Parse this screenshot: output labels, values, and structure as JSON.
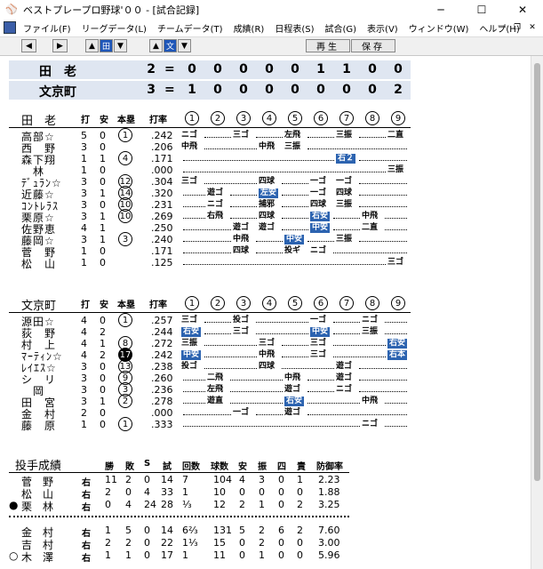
{
  "window": {
    "title": "ベストプレープロ野球'００ - [試合記録]",
    "minimize": "─",
    "maximize": "☐",
    "close": "✕"
  },
  "menu": [
    "ファイル(F)",
    "リーグデータ(L)",
    "チームデータ(T)",
    "成績(R)",
    "日程表(S)",
    "試合(G)",
    "表示(V)",
    "ウィンドウ(W)",
    "ヘルプ(H)"
  ],
  "toolbar": {
    "replay": "再生",
    "save": "保存",
    "ta": "田",
    "bun": "文"
  },
  "innings": [
    "1",
    "2",
    "3",
    "4",
    "5",
    "6",
    "7",
    "8",
    "9"
  ],
  "score": [
    {
      "team": "田　老",
      "total": "2",
      "eq": "=",
      "innings": [
        "0",
        "0",
        "0",
        "0",
        "0",
        "1",
        "1",
        "0",
        "0"
      ]
    },
    {
      "team": "文京町",
      "total": "3",
      "eq": "=",
      "innings": [
        "1",
        "0",
        "0",
        "0",
        "0",
        "0",
        "0",
        "0",
        "2"
      ]
    }
  ],
  "batting_headers": {
    "da": "打",
    "an": "安",
    "hr": "本塁",
    "avg": "打率"
  },
  "team1": {
    "name": "田　老",
    "players": [
      {
        "name": "高部☆",
        "ab": "5",
        "h": "0",
        "hr": "1",
        "hrstyle": "o",
        "avg": ".242",
        "res": [
          [
            0,
            "ニゴ"
          ],
          [
            2,
            "三ゴ"
          ],
          [
            4,
            "左飛"
          ],
          [
            6,
            "三振"
          ],
          [
            8,
            "二直"
          ]
        ]
      },
      {
        "name": "西　野",
        "ab": "3",
        "h": "0",
        "hr": "",
        "hrstyle": "",
        "avg": ".206",
        "res": [
          [
            0,
            "中飛"
          ],
          [
            3,
            "中飛"
          ],
          [
            4,
            "三振"
          ]
        ]
      },
      {
        "name": "森下翔",
        "ab": "1",
        "h": "1",
        "hr": "4",
        "hrstyle": "o",
        "avg": ".171",
        "res": [
          [
            6,
            "右２",
            "hl"
          ]
        ]
      },
      {
        "name": "　林",
        "ab": "1",
        "h": "0",
        "hr": "",
        "hrstyle": "",
        "avg": ".000",
        "res": [
          [
            8,
            "三振"
          ]
        ]
      },
      {
        "name": "ﾃﾞｭﾗﾝ☆",
        "ab": "3",
        "h": "0",
        "hr": "12",
        "hrstyle": "o",
        "avg": ".304",
        "res": [
          [
            0,
            "三ゴ"
          ],
          [
            3,
            "四球"
          ],
          [
            5,
            "一ゴ"
          ],
          [
            6,
            "一ゴ"
          ]
        ]
      },
      {
        "name": "近藤☆",
        "ab": "3",
        "h": "1",
        "hr": "14",
        "hrstyle": "o",
        "avg": ".320",
        "res": [
          [
            1,
            "遊ゴ"
          ],
          [
            3,
            "左安",
            "hl"
          ],
          [
            5,
            "一ゴ"
          ],
          [
            6,
            "四球"
          ]
        ]
      },
      {
        "name": "ｺﾝﾄﾚﾗｽ",
        "ab": "3",
        "h": "0",
        "hr": "10",
        "hrstyle": "o",
        "avg": ".231",
        "res": [
          [
            1,
            "ニゴ"
          ],
          [
            3,
            "捕邪"
          ],
          [
            5,
            "四球"
          ],
          [
            6,
            "三振"
          ]
        ]
      },
      {
        "name": "栗原☆",
        "ab": "3",
        "h": "1",
        "hr": "10",
        "hrstyle": "o",
        "avg": ".269",
        "res": [
          [
            1,
            "右飛"
          ],
          [
            3,
            "四球"
          ],
          [
            5,
            "右安",
            "hl"
          ],
          [
            7,
            "中飛"
          ]
        ]
      },
      {
        "name": "佐野恵",
        "ab": "4",
        "h": "1",
        "hr": "",
        "hrstyle": "",
        "avg": ".250",
        "res": [
          [
            2,
            "遊ゴ"
          ],
          [
            3,
            "遊ゴ"
          ],
          [
            5,
            "中安",
            "hl"
          ],
          [
            7,
            "二直"
          ]
        ]
      },
      {
        "name": "藤岡☆",
        "ab": "3",
        "h": "1",
        "hr": "3",
        "hrstyle": "o",
        "avg": ".240",
        "res": [
          [
            2,
            "中飛"
          ],
          [
            4,
            "中安",
            "hl"
          ],
          [
            6,
            "三振"
          ]
        ]
      },
      {
        "name": "菅　野",
        "ab": "1",
        "h": "0",
        "hr": "",
        "hrstyle": "",
        "avg": ".171",
        "res": [
          [
            2,
            "四球"
          ],
          [
            4,
            "投ギ"
          ],
          [
            5,
            "ニゴ"
          ]
        ]
      },
      {
        "name": "松　山",
        "ab": "1",
        "h": "0",
        "hr": "",
        "hrstyle": "",
        "avg": ".125",
        "res": [
          [
            8,
            "三ゴ"
          ]
        ]
      }
    ]
  },
  "team2": {
    "name": "文京町",
    "players": [
      {
        "name": "源田☆",
        "ab": "4",
        "h": "0",
        "hr": "1",
        "hrstyle": "o",
        "avg": ".257",
        "res": [
          [
            0,
            "三ゴ"
          ],
          [
            2,
            "投ゴ"
          ],
          [
            5,
            "一ゴ"
          ],
          [
            7,
            "ニゴ"
          ]
        ]
      },
      {
        "name": "荻　野",
        "ab": "4",
        "h": "2",
        "hr": "",
        "hrstyle": "",
        "avg": ".244",
        "res": [
          [
            0,
            "右安",
            "hl"
          ],
          [
            2,
            "三ゴ"
          ],
          [
            5,
            "中安",
            "hl"
          ],
          [
            7,
            "三振"
          ]
        ]
      },
      {
        "name": "村　上",
        "ab": "4",
        "h": "1",
        "hr": "8",
        "hrstyle": "o",
        "avg": ".272",
        "res": [
          [
            0,
            "三振"
          ],
          [
            3,
            "三ゴ"
          ],
          [
            5,
            "三ゴ"
          ],
          [
            8,
            "右安",
            "hl"
          ]
        ]
      },
      {
        "name": "ﾏｰﾃｨﾝ☆",
        "ab": "4",
        "h": "2",
        "hr": "17",
        "hrstyle": "f",
        "avg": ".242",
        "res": [
          [
            0,
            "中安",
            "hl"
          ],
          [
            3,
            "中飛"
          ],
          [
            5,
            "三ゴ"
          ],
          [
            8,
            "右本",
            "hl"
          ]
        ]
      },
      {
        "name": "ﾚｲｴｽ☆",
        "ab": "3",
        "h": "0",
        "hr": "13",
        "hrstyle": "o",
        "avg": ".238",
        "res": [
          [
            0,
            "投ゴ"
          ],
          [
            3,
            "四球"
          ],
          [
            6,
            "遊ゴ"
          ]
        ]
      },
      {
        "name": "シ　リ",
        "ab": "3",
        "h": "0",
        "hr": "9",
        "hrstyle": "o",
        "avg": ".260",
        "res": [
          [
            1,
            "二飛"
          ],
          [
            4,
            "中飛"
          ],
          [
            6,
            "遊ゴ"
          ]
        ]
      },
      {
        "name": "　岡",
        "ab": "3",
        "h": "0",
        "hr": "3",
        "hrstyle": "o",
        "avg": ".236",
        "res": [
          [
            1,
            "左飛"
          ],
          [
            4,
            "遊ゴ"
          ],
          [
            6,
            "ニゴ"
          ]
        ]
      },
      {
        "name": "田　宮",
        "ab": "3",
        "h": "1",
        "hr": "2",
        "hrstyle": "o",
        "avg": ".278",
        "res": [
          [
            1,
            "遊直"
          ],
          [
            4,
            "右安",
            "hl"
          ],
          [
            7,
            "中飛"
          ]
        ]
      },
      {
        "name": "金　村",
        "ab": "2",
        "h": "0",
        "hr": "",
        "hrstyle": "",
        "avg": ".000",
        "res": [
          [
            2,
            "一ゴ"
          ],
          [
            4,
            "遊ゴ"
          ]
        ]
      },
      {
        "name": "藤　原",
        "ab": "1",
        "h": "0",
        "hr": "1",
        "hrstyle": "o",
        "avg": ".333",
        "res": [
          [
            7,
            "ニゴ"
          ]
        ]
      }
    ]
  },
  "pitching": {
    "title": "投手成績",
    "headers": [
      "勝",
      "敗",
      "S",
      "試",
      "回数",
      "球数",
      "安",
      "振",
      "四",
      "責",
      "防御率"
    ],
    "team1": [
      {
        "mark": "",
        "name": "菅　野",
        "hand": "右",
        "w": "11",
        "l": "2",
        "s": "0",
        "g": "14",
        "ip": "7",
        "np": "104",
        "h": "4",
        "k": "3",
        "bb": "0",
        "er": "1",
        "era": "2.23"
      },
      {
        "mark": "",
        "name": "松　山",
        "hand": "右",
        "w": "2",
        "l": "0",
        "s": "4",
        "g": "33",
        "ip": "1",
        "np": "10",
        "h": "0",
        "k": "0",
        "bb": "0",
        "er": "0",
        "era": "1.88"
      },
      {
        "mark": "●",
        "name": "栗　林",
        "hand": "右",
        "w": "0",
        "l": "4",
        "s": "24",
        "g": "28",
        "ip": "⅓",
        "np": "12",
        "h": "2",
        "k": "1",
        "bb": "0",
        "er": "2",
        "era": "3.25"
      }
    ],
    "team2": [
      {
        "mark": "",
        "name": "金　村",
        "hand": "右",
        "w": "1",
        "l": "5",
        "s": "0",
        "g": "14",
        "ip": "6⅔",
        "np": "131",
        "h": "5",
        "k": "2",
        "bb": "6",
        "er": "2",
        "era": "7.60"
      },
      {
        "mark": "",
        "name": "吉　村",
        "hand": "右",
        "w": "2",
        "l": "2",
        "s": "0",
        "g": "22",
        "ip": "1⅓",
        "np": "15",
        "h": "0",
        "k": "2",
        "bb": "0",
        "er": "0",
        "era": "3.00"
      },
      {
        "mark": "○",
        "name": "木　澤",
        "hand": "右",
        "w": "1",
        "l": "1",
        "s": "0",
        "g": "17",
        "ip": "1",
        "np": "11",
        "h": "0",
        "k": "1",
        "bb": "0",
        "er": "0",
        "era": "5.96"
      }
    ]
  }
}
